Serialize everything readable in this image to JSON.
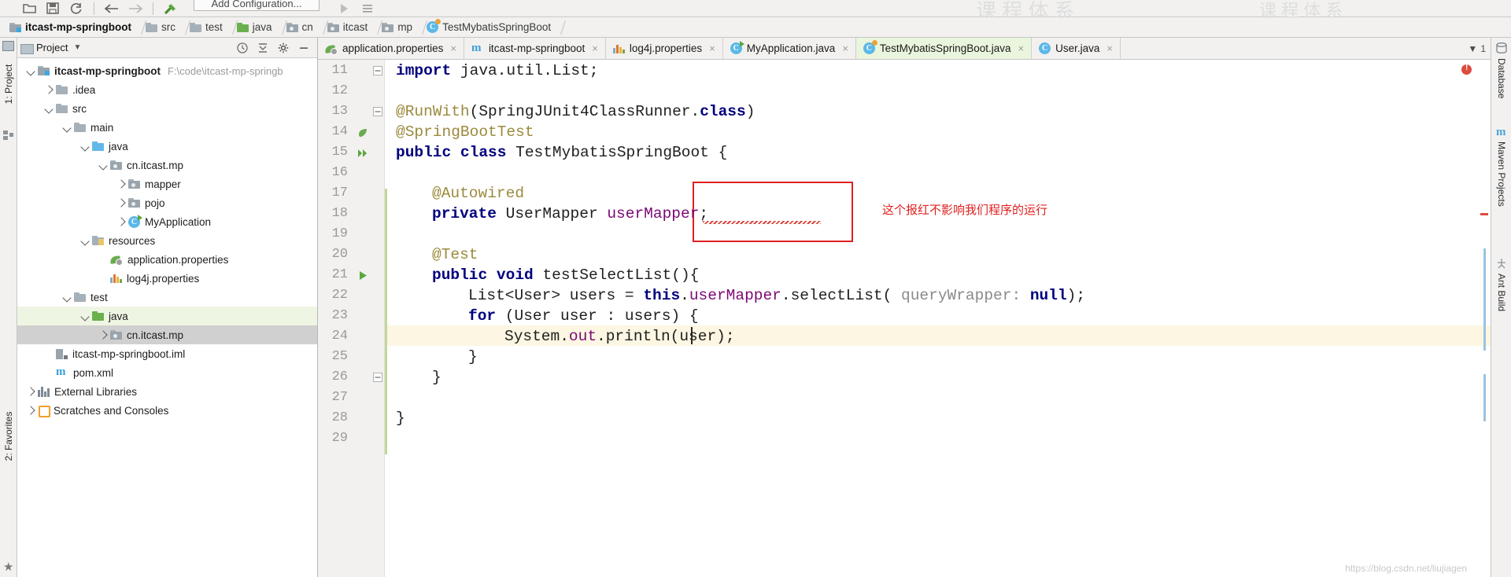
{
  "toolbar": {
    "icons": [
      "open-folder-icon",
      "save-icon",
      "sync-icon",
      "back-arrow-icon",
      "forward-arrow-icon",
      "build-hammer-icon"
    ],
    "run_config_label": "Add Configuration...",
    "run_icon": "run-play-icon",
    "more_icon": "more-options-icon"
  },
  "breadcrumb": {
    "items": [
      {
        "label": "itcast-mp-springboot",
        "icon": "module-folder-icon"
      },
      {
        "label": "src",
        "icon": "folder-icon"
      },
      {
        "label": "test",
        "icon": "folder-icon"
      },
      {
        "label": "java",
        "icon": "source-folder-icon"
      },
      {
        "label": "cn",
        "icon": "package-icon"
      },
      {
        "label": "itcast",
        "icon": "package-icon"
      },
      {
        "label": "mp",
        "icon": "package-icon"
      },
      {
        "label": "TestMybatisSpringBoot",
        "icon": "java-test-class-icon"
      }
    ]
  },
  "left_rail": {
    "project_label": "1: Project",
    "favorites_label": "2: Favorites",
    "structure_icon": "structure-icon",
    "star_icon": "star-icon"
  },
  "right_rail": {
    "items": [
      "Database",
      "Maven Projects",
      "Ant Build"
    ]
  },
  "project_panel": {
    "title": "Project",
    "dropdown_icon": "chevron-down-icon",
    "header_icons": [
      "collapse-history-icon",
      "collapse-all-icon",
      "settings-gear-icon",
      "hide-minus-icon"
    ],
    "tree": [
      {
        "depth": 0,
        "chevron": "down",
        "icon": "module-folder-icon",
        "label": "itcast-mp-springboot",
        "bold": true,
        "path": "F:\\code\\itcast-mp-springb",
        "hl": ""
      },
      {
        "depth": 1,
        "chevron": "right",
        "icon": "folder-icon",
        "label": ".idea",
        "bold": false,
        "path": "",
        "hl": ""
      },
      {
        "depth": 1,
        "chevron": "down",
        "icon": "folder-icon",
        "label": "src",
        "bold": false,
        "path": "",
        "hl": ""
      },
      {
        "depth": 2,
        "chevron": "down",
        "icon": "folder-icon",
        "label": "main",
        "bold": false,
        "path": "",
        "hl": ""
      },
      {
        "depth": 3,
        "chevron": "down",
        "icon": "source-folder-blue-icon",
        "label": "java",
        "bold": false,
        "path": "",
        "hl": ""
      },
      {
        "depth": 4,
        "chevron": "down",
        "icon": "package-icon",
        "label": "cn.itcast.mp",
        "bold": false,
        "path": "",
        "hl": ""
      },
      {
        "depth": 5,
        "chevron": "right",
        "icon": "package-icon",
        "label": "mapper",
        "bold": false,
        "path": "",
        "hl": ""
      },
      {
        "depth": 5,
        "chevron": "right",
        "icon": "package-icon",
        "label": "pojo",
        "bold": false,
        "path": "",
        "hl": ""
      },
      {
        "depth": 5,
        "chevron": "right",
        "icon": "spring-class-icon",
        "label": "MyApplication",
        "bold": false,
        "path": "",
        "hl": ""
      },
      {
        "depth": 3,
        "chevron": "down",
        "icon": "resources-folder-icon",
        "label": "resources",
        "bold": false,
        "path": "",
        "hl": ""
      },
      {
        "depth": 4,
        "chevron": "none",
        "icon": "spring-leaf-icon",
        "label": "application.properties",
        "bold": false,
        "path": "",
        "hl": ""
      },
      {
        "depth": 4,
        "chevron": "none",
        "icon": "log-properties-icon",
        "label": "log4j.properties",
        "bold": false,
        "path": "",
        "hl": ""
      },
      {
        "depth": 2,
        "chevron": "down",
        "icon": "folder-icon",
        "label": "test",
        "bold": false,
        "path": "",
        "hl": ""
      },
      {
        "depth": 3,
        "chevron": "down",
        "icon": "test-source-folder-icon",
        "label": "java",
        "bold": false,
        "path": "",
        "hl": "green"
      },
      {
        "depth": 4,
        "chevron": "right",
        "icon": "package-icon",
        "label": "cn.itcast.mp",
        "bold": false,
        "path": "",
        "hl": "gray"
      },
      {
        "depth": 1,
        "chevron": "none",
        "icon": "iml-file-icon",
        "label": "itcast-mp-springboot.iml",
        "bold": false,
        "path": "",
        "hl": ""
      },
      {
        "depth": 1,
        "chevron": "none",
        "icon": "maven-pom-icon",
        "label": "pom.xml",
        "bold": false,
        "path": "",
        "hl": ""
      },
      {
        "depth": 0,
        "chevron": "right",
        "icon": "external-libraries-icon",
        "label": "External Libraries",
        "bold": false,
        "path": "",
        "hl": ""
      },
      {
        "depth": 0,
        "chevron": "right",
        "icon": "scratches-icon",
        "label": "Scratches and Consoles",
        "bold": false,
        "path": "",
        "hl": ""
      }
    ]
  },
  "editor": {
    "tabs": [
      {
        "label": "application.properties",
        "icon": "spring-leaf-icon",
        "active": false
      },
      {
        "label": "itcast-mp-springboot",
        "icon": "maven-pom-icon",
        "active": false
      },
      {
        "label": "log4j.properties",
        "icon": "log-properties-icon",
        "active": false
      },
      {
        "label": "MyApplication.java",
        "icon": "spring-class-icon",
        "active": false
      },
      {
        "label": "TestMybatisSpringBoot.java",
        "icon": "java-test-class-icon",
        "active": true
      },
      {
        "label": "User.java",
        "icon": "java-class-icon",
        "active": false
      }
    ],
    "close_glyph": "×",
    "tab_overflow_label": "1",
    "first_line_number": 11,
    "last_line_number": 29,
    "error_badge_icon": "error-indicator-icon",
    "annotation_text": "这个报红不影响我们程序的运行",
    "annotation_color": "#e02020",
    "watermark": "https://blog.csdn.net/liujiagen",
    "ghost_text": "课 程 体 系",
    "lines": [
      {
        "n": 11,
        "indent": 0,
        "gutter": "fold-collapse",
        "tokens": [
          {
            "t": "import ",
            "c": "kw"
          },
          {
            "t": "java.util.List;",
            "c": ""
          }
        ]
      },
      {
        "n": 12,
        "indent": 0,
        "gutter": "",
        "tokens": []
      },
      {
        "n": 13,
        "indent": 0,
        "gutter": "fold-collapse",
        "tokens": [
          {
            "t": "@RunWith",
            "c": "ann"
          },
          {
            "t": "(SpringJUnit4ClassRunner.",
            "c": ""
          },
          {
            "t": "class",
            "c": "kw"
          },
          {
            "t": ")",
            "c": ""
          }
        ]
      },
      {
        "n": 14,
        "indent": 0,
        "gutter": "spring-leaf",
        "tokens": [
          {
            "t": "@SpringBootTest",
            "c": "ann"
          }
        ]
      },
      {
        "n": 15,
        "indent": 0,
        "gutter": "run-all-tests",
        "tokens": [
          {
            "t": "public class ",
            "c": "kw"
          },
          {
            "t": "TestMybatisSpringBoot {",
            "c": ""
          }
        ]
      },
      {
        "n": 16,
        "indent": 0,
        "gutter": "",
        "tokens": []
      },
      {
        "n": 17,
        "indent": 1,
        "gutter": "",
        "tokens": [
          {
            "t": "@Autowired",
            "c": "ann"
          }
        ]
      },
      {
        "n": 18,
        "indent": 1,
        "gutter": "",
        "tokens": [
          {
            "t": "private ",
            "c": "kw"
          },
          {
            "t": "UserMapper ",
            "c": ""
          },
          {
            "t": "userMapper",
            "c": "fld"
          },
          {
            "t": ";",
            "c": ""
          }
        ]
      },
      {
        "n": 19,
        "indent": 0,
        "gutter": "",
        "tokens": []
      },
      {
        "n": 20,
        "indent": 1,
        "gutter": "",
        "tokens": [
          {
            "t": "@Test",
            "c": "ann"
          }
        ]
      },
      {
        "n": 21,
        "indent": 1,
        "gutter": "run-test",
        "tokens": [
          {
            "t": "public void ",
            "c": "kw"
          },
          {
            "t": "testSelectList(){",
            "c": ""
          }
        ]
      },
      {
        "n": 22,
        "indent": 2,
        "gutter": "",
        "tokens": [
          {
            "t": "List<User> users = ",
            "c": ""
          },
          {
            "t": "this",
            "c": "kw"
          },
          {
            "t": ".",
            "c": ""
          },
          {
            "t": "userMapper",
            "c": "fld"
          },
          {
            "t": ".selectList( ",
            "c": ""
          },
          {
            "t": "queryWrapper:",
            "c": "param"
          },
          {
            "t": " ",
            "c": ""
          },
          {
            "t": "null",
            "c": "kw"
          },
          {
            "t": ");",
            "c": ""
          }
        ]
      },
      {
        "n": 23,
        "indent": 2,
        "gutter": "",
        "tokens": [
          {
            "t": "for ",
            "c": "kw"
          },
          {
            "t": "(User user : users) {",
            "c": ""
          }
        ]
      },
      {
        "n": 24,
        "indent": 3,
        "gutter": "",
        "tokens": [
          {
            "t": "System.",
            "c": ""
          },
          {
            "t": "out",
            "c": "fld"
          },
          {
            "t": ".println(user);",
            "c": ""
          }
        ]
      },
      {
        "n": 25,
        "indent": 2,
        "gutter": "",
        "tokens": [
          {
            "t": "}",
            "c": ""
          }
        ]
      },
      {
        "n": 26,
        "indent": 1,
        "gutter": "fold-collapse",
        "tokens": [
          {
            "t": "}",
            "c": ""
          }
        ]
      },
      {
        "n": 27,
        "indent": 0,
        "gutter": "",
        "tokens": []
      },
      {
        "n": 28,
        "indent": 0,
        "gutter": "",
        "tokens": [
          {
            "t": "}",
            "c": ""
          }
        ]
      },
      {
        "n": 29,
        "indent": 0,
        "gutter": "",
        "tokens": []
      }
    ]
  }
}
